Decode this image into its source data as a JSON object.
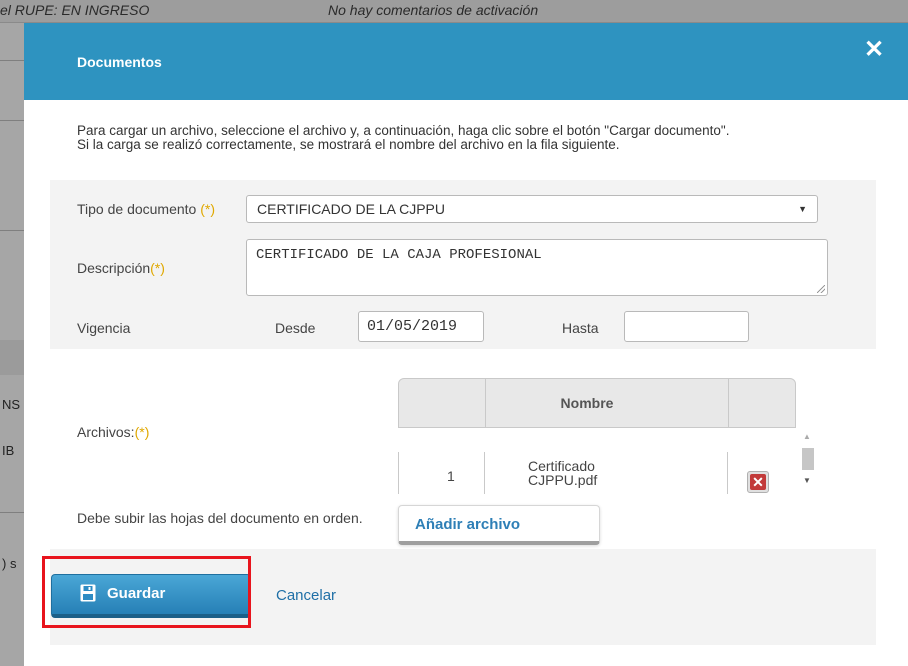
{
  "background": {
    "strip_text_left": "el RUPE:  EN INGRESO",
    "strip_text_right": "No hay comentarios de activación",
    "frag_1": "NS",
    "frag_2": "IB",
    "frag_3": ") s"
  },
  "modal": {
    "title": "Documentos",
    "close_label": "✕",
    "instructions_1": "Para cargar un archivo, seleccione el archivo y, a continuación, haga clic sobre el botón \"Cargar documento\".",
    "instructions_2": "Si la carga se realizó correctamente, se mostrará el nombre del archivo en la fila siguiente.",
    "required_mark": "(*)",
    "doc_type": {
      "label": "Tipo de documento",
      "selected": "CERTIFICADO DE LA CJPPU"
    },
    "description": {
      "label": "Descripción",
      "value": "CERTIFICADO DE LA CAJA PROFESIONAL"
    },
    "validity": {
      "label": "Vigencia",
      "from_label": "Desde",
      "from_value": "01/05/2019",
      "to_label": "Hasta",
      "to_value": ""
    },
    "files": {
      "label": "Archivos:",
      "column_name": "Nombre",
      "rows": [
        {
          "num": "1",
          "name_line1": "Certificado",
          "name_line2": "CJPPU.pdf"
        }
      ],
      "add_label": "Añadir archivo"
    },
    "hint": "Debe subir las hojas del documento en orden.",
    "save_label": "Guardar",
    "cancel_label": "Cancelar"
  },
  "colors": {
    "header": "#2e93c0",
    "required": "#e0a800",
    "highlight": "#e8141d"
  }
}
